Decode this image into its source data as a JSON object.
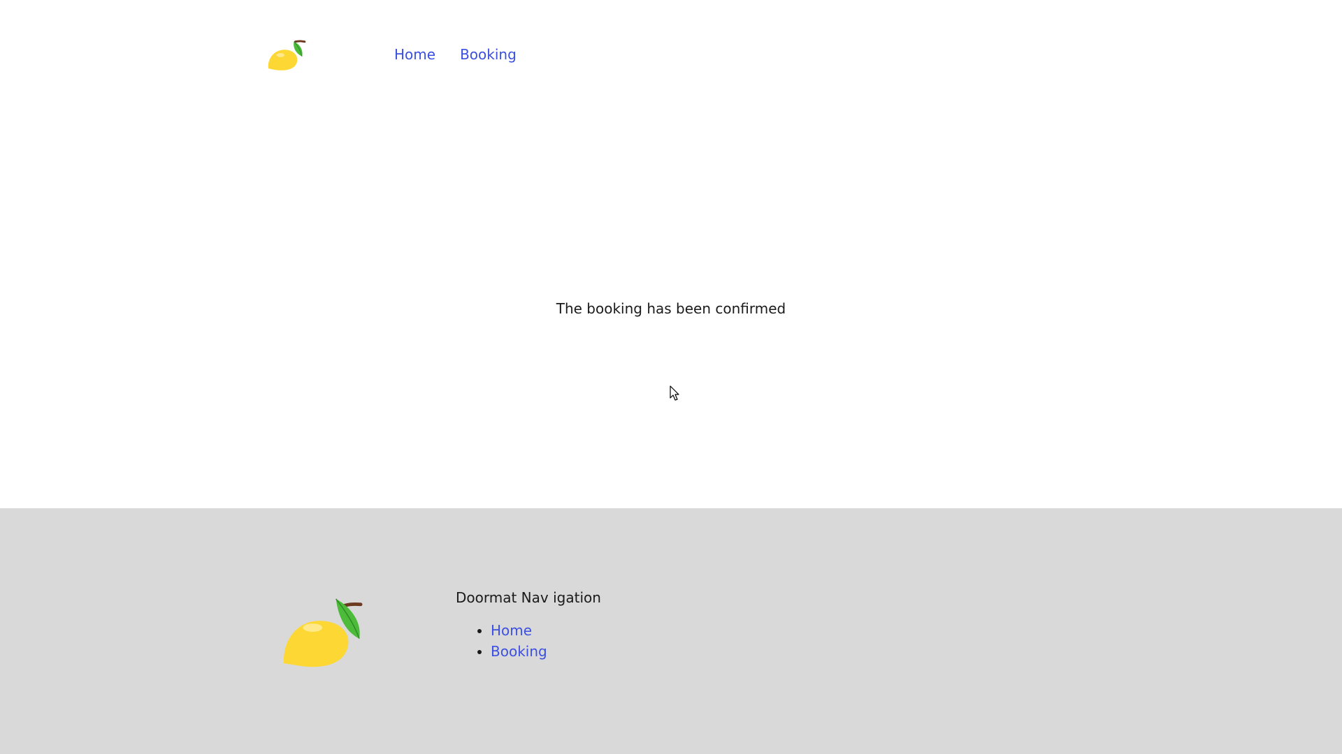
{
  "header": {
    "logo_icon": "lemon-icon",
    "nav": [
      {
        "label": "Home"
      },
      {
        "label": "Booking"
      }
    ]
  },
  "main": {
    "message": "The booking has been confirmed"
  },
  "footer": {
    "logo_icon": "lemon-icon",
    "doormat_title": "Doormat Nav igation",
    "links": [
      {
        "label": "Home"
      },
      {
        "label": "Booking"
      }
    ]
  },
  "colors": {
    "link": "#3b4fe0",
    "footer_bg": "#d9d9d9",
    "lemon": "#fdd835",
    "leaf": "#4caf50",
    "stem": "#795548"
  }
}
